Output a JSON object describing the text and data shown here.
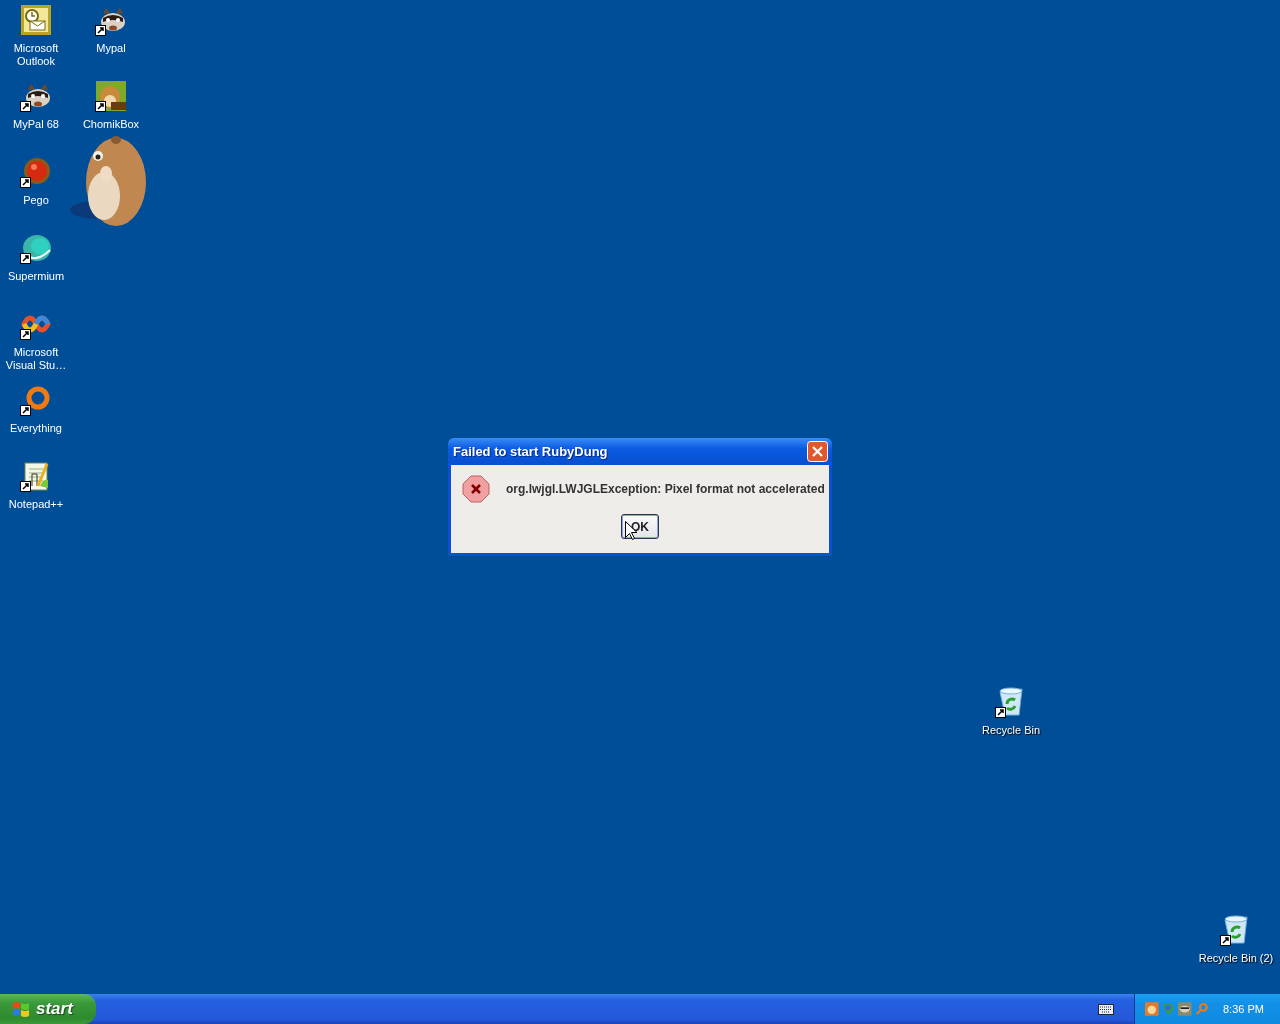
{
  "desktop": {
    "icons": [
      {
        "label": "Microsoft Outlook",
        "kind": "outlook",
        "shortcut": false
      },
      {
        "label": "Mypal",
        "kind": "raccoon",
        "shortcut": true
      },
      {
        "label": "MyPal 68",
        "kind": "raccoon",
        "shortcut": true
      },
      {
        "label": "ChomikBox",
        "kind": "chomikbox",
        "shortcut": true
      },
      {
        "label": "Pego",
        "kind": "pego",
        "shortcut": true
      },
      {
        "label": "Supermium",
        "kind": "supermium",
        "shortcut": true
      },
      {
        "label": "Microsoft Visual Stu…",
        "kind": "visualstudio",
        "shortcut": true
      },
      {
        "label": "Everything",
        "kind": "everything",
        "shortcut": true
      },
      {
        "label": "Notepad++",
        "kind": "notepad",
        "shortcut": true
      },
      {
        "label": "Recycle Bin",
        "kind": "recycle",
        "shortcut": true
      },
      {
        "label": "Recycle Bin (2)",
        "kind": "recycle",
        "shortcut": true
      }
    ]
  },
  "dialog": {
    "title": "Failed to start RubyDung",
    "message": "org.lwjgl.LWJGLException: Pixel format not accelerated",
    "buttons": [
      "OK"
    ]
  },
  "taskbar": {
    "start_label": "start",
    "tray_icons": [
      {
        "kind": "chomik"
      },
      {
        "kind": "update"
      },
      {
        "kind": "raccoon"
      },
      {
        "kind": "search"
      }
    ],
    "clock": "8:36 PM"
  }
}
